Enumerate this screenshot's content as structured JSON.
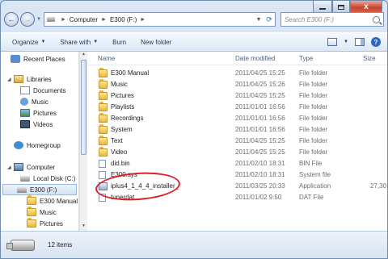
{
  "window": {
    "caption_buttons": [
      "minimize",
      "maximize",
      "close"
    ],
    "close_glyph": "x"
  },
  "nav": {
    "back_glyph": "←",
    "forward_glyph": "→",
    "breadcrumb": [
      "Computer",
      "E300 (F:)"
    ],
    "search_placeholder": "Search E300 (F:)"
  },
  "toolbar": {
    "organize": "Organize",
    "share_with": "Share with",
    "burn": "Burn",
    "new_folder": "New folder"
  },
  "sidebar": {
    "items": [
      {
        "label": "Recent Places",
        "icon": "star-icon",
        "indent": 1
      },
      {
        "label": "Libraries",
        "icon": "libraries-icon",
        "indent": 0,
        "expanded": true
      },
      {
        "label": "Documents",
        "icon": "documents-icon",
        "indent": 1
      },
      {
        "label": "Music",
        "icon": "music-icon",
        "indent": 1
      },
      {
        "label": "Pictures",
        "icon": "pictures-icon",
        "indent": 1
      },
      {
        "label": "Videos",
        "icon": "videos-icon",
        "indent": 1
      },
      {
        "label": "Homegroup",
        "icon": "homegroup-icon",
        "indent": 0
      },
      {
        "label": "Computer",
        "icon": "computer-icon",
        "indent": 0,
        "expanded": true
      },
      {
        "label": "Local Disk (C:)",
        "icon": "disk-icon",
        "indent": 1
      },
      {
        "label": "E300 (F:)",
        "icon": "drive-icon",
        "indent": 1,
        "selected": true
      },
      {
        "label": "E300 Manual",
        "icon": "folder-icon",
        "indent": 2
      },
      {
        "label": "Music",
        "icon": "folder-icon",
        "indent": 2
      },
      {
        "label": "Pictures",
        "icon": "folder-icon",
        "indent": 2
      }
    ]
  },
  "columns": {
    "name": "Name",
    "date_modified": "Date modified",
    "type": "Type",
    "size": "Size"
  },
  "files": [
    {
      "name": "E300 Manual",
      "date": "2011/04/25 15:25",
      "type": "File folder",
      "size": "",
      "icon": "folder-icon"
    },
    {
      "name": "Music",
      "date": "2011/04/25 15:26",
      "type": "File folder",
      "size": "",
      "icon": "folder-icon"
    },
    {
      "name": "Pictures",
      "date": "2011/04/25 15:25",
      "type": "File folder",
      "size": "",
      "icon": "folder-icon"
    },
    {
      "name": "Playlists",
      "date": "2011/01/01 16:56",
      "type": "File folder",
      "size": "",
      "icon": "folder-icon"
    },
    {
      "name": "Recordings",
      "date": "2011/01/01 16:56",
      "type": "File folder",
      "size": "",
      "icon": "folder-icon"
    },
    {
      "name": "System",
      "date": "2011/01/01 16:56",
      "type": "File folder",
      "size": "",
      "icon": "folder-icon"
    },
    {
      "name": "Text",
      "date": "2011/04/25 15:25",
      "type": "File folder",
      "size": "",
      "icon": "folder-icon"
    },
    {
      "name": "Video",
      "date": "2011/04/25 15:25",
      "type": "File folder",
      "size": "",
      "icon": "folder-icon"
    },
    {
      "name": "did.bin",
      "date": "2011/02/10 18:31",
      "type": "BIN File",
      "size": "",
      "icon": "file-icon"
    },
    {
      "name": "E300.sys",
      "date": "2011/02/10 18:31",
      "type": "System file",
      "size": "",
      "icon": "file-icon"
    },
    {
      "name": "iplus4_1_4_4_installer_",
      "date": "2011/03/25 20:33",
      "type": "Application",
      "size": "27,30",
      "icon": "application-icon"
    },
    {
      "name": "tunerdat",
      "date": "2011/01/02 9:50",
      "type": "DAT File",
      "size": "",
      "icon": "file-icon"
    }
  ],
  "status": {
    "item_count": "12 items"
  },
  "colors": {
    "annotation": "#d8222a",
    "selection": "#d2e2f6"
  }
}
